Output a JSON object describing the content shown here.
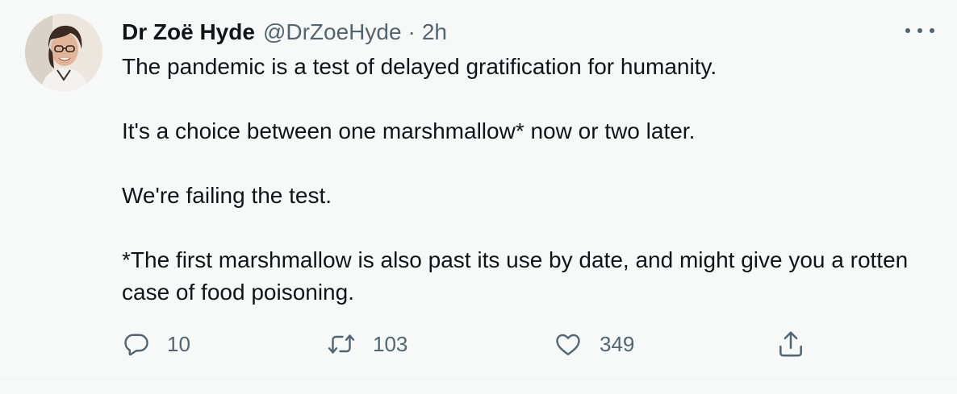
{
  "tweet": {
    "author": {
      "name": "Dr Zoë Hyde",
      "handle": "@DrZoeHyde",
      "separator": "·",
      "time": "2h"
    },
    "paragraphs": [
      "The pandemic is a test of delayed gratification for humanity.",
      "It's a choice between one marshmallow* now or two later.",
      "We're failing the test.",
      "*The first marshmallow is also past its use by date, and might give you a rotten case of food poisoning."
    ],
    "actions": {
      "reply": {
        "icon": "reply-icon",
        "count": "10"
      },
      "retweet": {
        "icon": "retweet-icon",
        "count": "103"
      },
      "like": {
        "icon": "heart-icon",
        "count": "349"
      },
      "share": {
        "icon": "share-icon"
      }
    }
  },
  "colors": {
    "background": "#f7f9f9",
    "text": "#0f1419",
    "secondary": "#536471"
  }
}
